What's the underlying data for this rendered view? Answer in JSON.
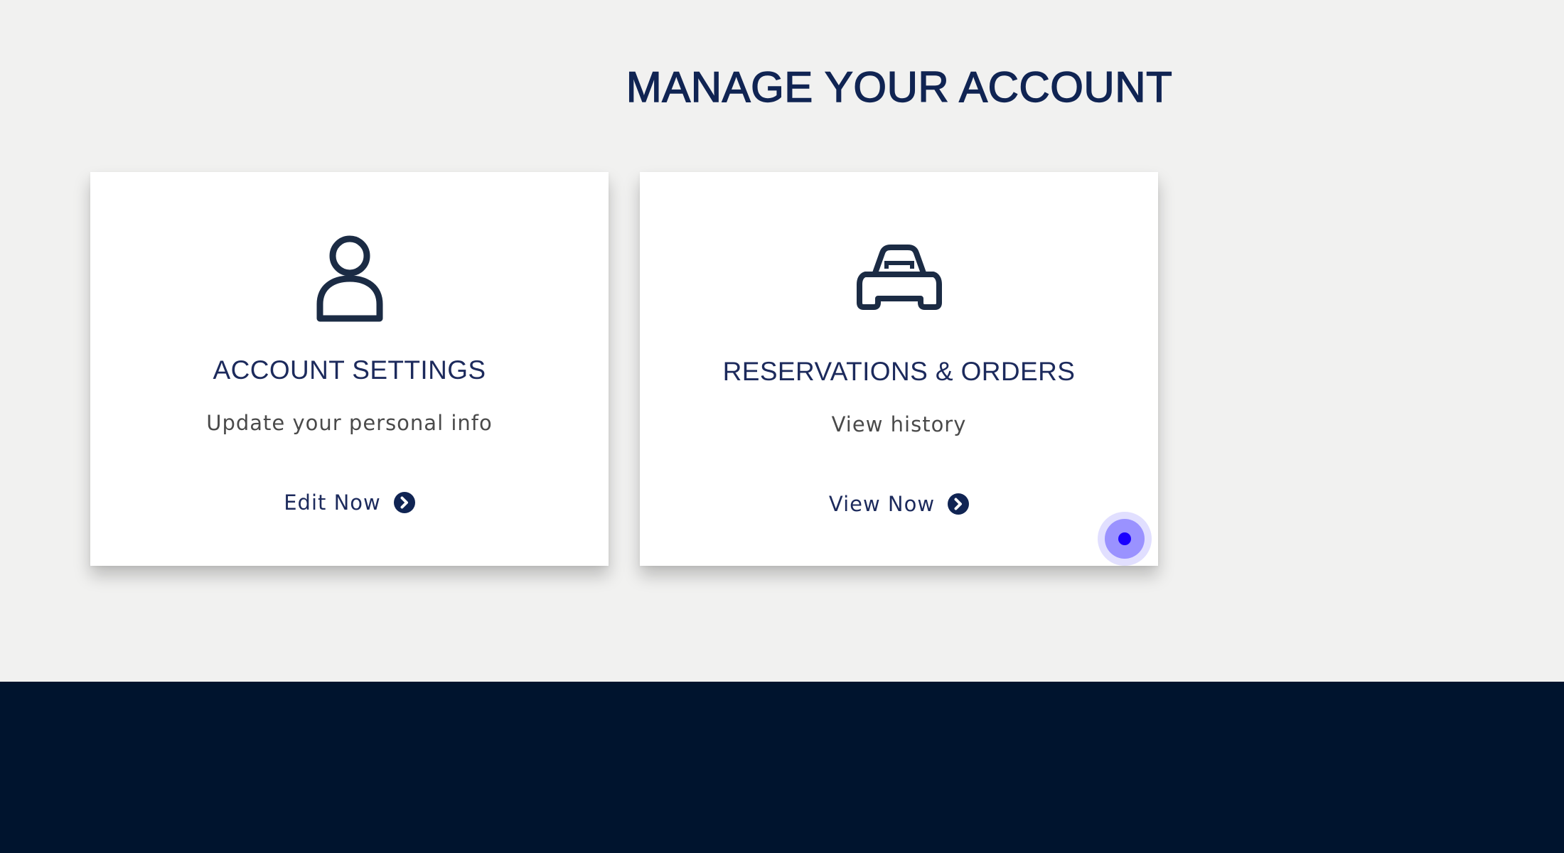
{
  "page": {
    "title": "MANAGE YOUR ACCOUNT"
  },
  "cards": [
    {
      "title": "ACCOUNT SETTINGS",
      "subtitle": "Update your personal info",
      "link_label": "Edit Now",
      "icon": "person-icon"
    },
    {
      "title": "RESERVATIONS & ORDERS",
      "subtitle": "View history",
      "link_label": "View Now",
      "icon": "car-icon"
    }
  ],
  "colors": {
    "background": "#f1f1f0",
    "heading": "#102453",
    "card_title": "#1c2a5c",
    "subtitle": "#4a4a4a",
    "footer": "#00142e",
    "cursor": "#1a00ff"
  }
}
